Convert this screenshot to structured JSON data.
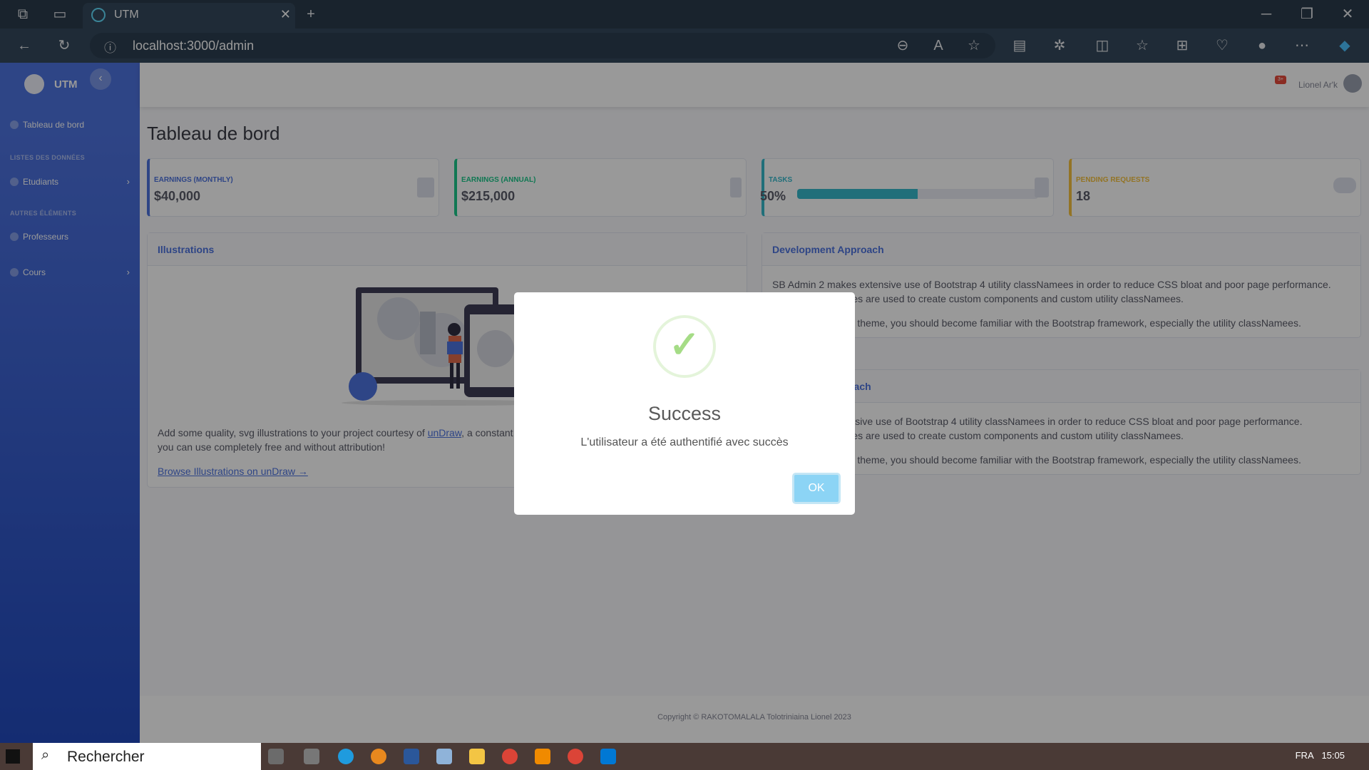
{
  "browser": {
    "tab_title": "UTM",
    "url": "localhost:3000/admin"
  },
  "sidebar": {
    "brand": "UTM",
    "toggle": "‹",
    "items": [
      {
        "label": "Tableau de bord"
      },
      {
        "heading": "LISTES DES DONNÉES"
      },
      {
        "label": "Etudiants",
        "chevron": "›"
      },
      {
        "heading": "AUTRES ÉLÉMENTS"
      },
      {
        "label": "Professeurs"
      },
      {
        "label": "Cours",
        "chevron": "›"
      }
    ]
  },
  "topbar": {
    "alert_badge": "3+",
    "user_name": "Lionel Ar'k"
  },
  "page": {
    "title": "Tableau de bord"
  },
  "stats": [
    {
      "label": "EARNINGS (MONTHLY)",
      "value": "$40,000",
      "color": "#4e73df"
    },
    {
      "label": "EARNINGS (ANNUAL)",
      "value": "$215,000",
      "color": "#1cc88a"
    },
    {
      "label": "TASKS",
      "value": "50%",
      "color": "#36b9cc",
      "progress": 0.5
    },
    {
      "label": "PENDING REQUESTS",
      "value": "18",
      "color": "#f6c23e"
    }
  ],
  "illustrations": {
    "title": "Illustrations",
    "text_before": "Add some quality, svg illustrations to your project courtesy of ",
    "link": "unDraw",
    "text_after": ", a constant",
    "text_line2": "you can use completely free and without attribution!",
    "browse_link": "Browse Illustrations on unDraw →"
  },
  "approach1": {
    "title": "Development Approach",
    "p1a": "SB Admin 2 makes extensive use of Bootstrap 4 utility classNamees in order to reduce CSS bloat and poor page performance.",
    "p1b": "lamees are used to create custom components and custom utility classNamees.",
    "p2": "h this theme, you should become familiar with the Bootstrap framework, especially the utility classNamees."
  },
  "approach2": {
    "title": "proach",
    "p1a": "extensive use of Bootstrap 4 utility classNamees in order to reduce CSS bloat and poor page performance.",
    "p1b": "lamees are used to create custom components and custom utility classNamees.",
    "p2": "h this theme, you should become familiar with the Bootstrap framework, especially the utility classNamees."
  },
  "footer": {
    "copyright": "Copyright © RAKOTOMALALA Tolotriniaina Lionel 2023"
  },
  "modal": {
    "title": "Success",
    "message": "L'utilisateur a été authentifié avec succès",
    "ok": "OK",
    "check": "✓"
  },
  "taskbar": {
    "search_placeholder": "Rechercher",
    "tray_lang": "FRA",
    "tray_time": "15:05"
  }
}
